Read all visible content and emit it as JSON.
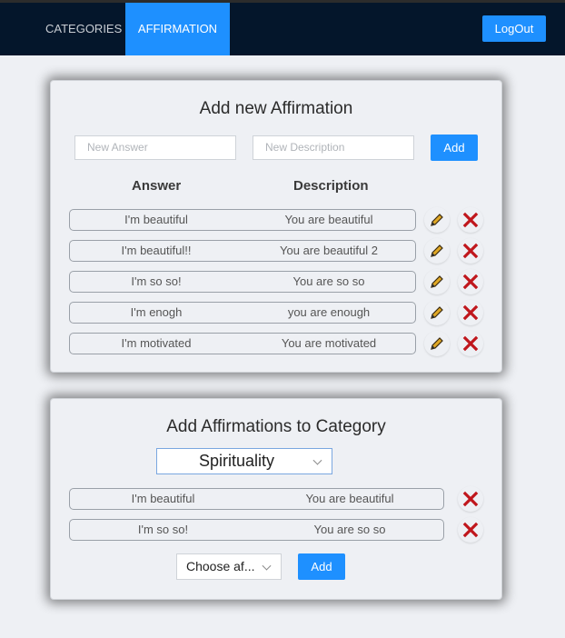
{
  "nav": {
    "categories_label": "CATEGORIES",
    "affirmation_label": "AFFIRMATION",
    "logout_label": "LogOut"
  },
  "add_affirmation": {
    "title": "Add new Affirmation",
    "answer_placeholder": "New Answer",
    "description_placeholder": "New Description",
    "add_label": "Add",
    "col_answer": "Answer",
    "col_description": "Description",
    "rows": [
      {
        "answer": "I'm beautiful",
        "description": "You are beautiful"
      },
      {
        "answer": "I'm beautiful!!",
        "description": "You are beautiful 2"
      },
      {
        "answer": "I'm so so!",
        "description": "You are so so"
      },
      {
        "answer": "I'm enogh",
        "description": "you are enough"
      },
      {
        "answer": "I'm motivated",
        "description": "You are motivated"
      }
    ]
  },
  "category": {
    "title": "Add Affirmations to Category",
    "selected_category": "Spirituality",
    "rows": [
      {
        "answer": "I'm beautiful",
        "description": "You are beautiful"
      },
      {
        "answer": "I'm so so!",
        "description": "You are so so"
      }
    ],
    "choose_label": "Choose af...",
    "add_label": "Add"
  },
  "colors": {
    "nav_bg": "#04162b",
    "accent": "#1e90ff",
    "delete": "#c0161c",
    "edit": "#e0a826"
  },
  "icons": {
    "edit": "pencil-icon",
    "delete": "delete-x-icon",
    "dropdown": "chevron-down-icon"
  }
}
